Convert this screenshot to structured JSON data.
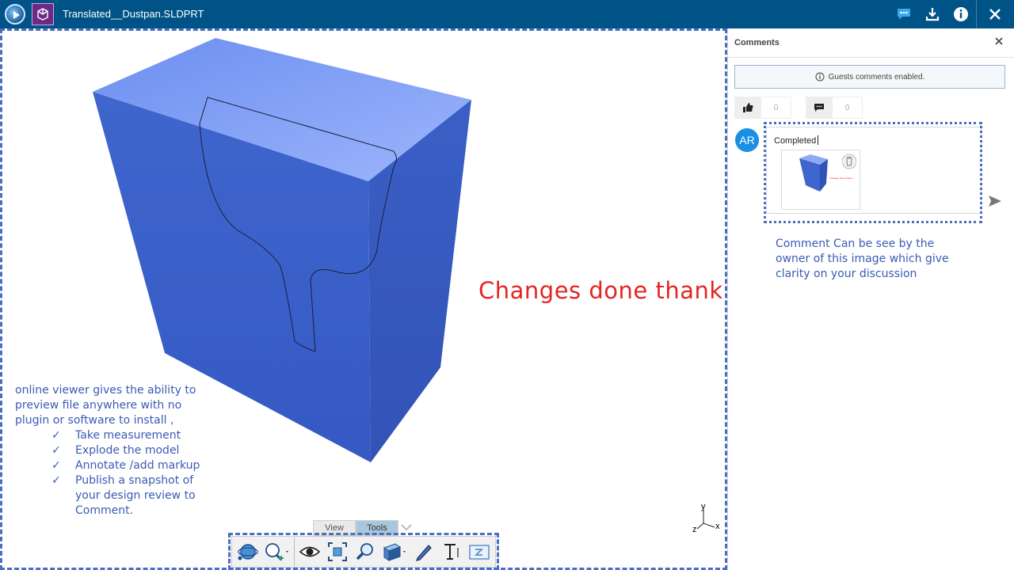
{
  "app": {
    "title": "Translated__Dustpan.SLDPRT",
    "logo_icon": "3d-viewer-play-icon",
    "part_icon": "part-cube-icon",
    "header_buttons": [
      "comments-icon",
      "download-icon",
      "info-icon",
      "close-icon"
    ]
  },
  "viewport": {
    "annotation": {
      "intro_lines": [
        "online viewer gives the ability to",
        "preview file anywhere with no",
        "plugin  or software to install ,"
      ],
      "features": [
        "Take measurement",
        "Explode the model",
        "Annotate  /add markup",
        "Publish  a snapshot  of"
      ],
      "feature_continuation": [
        "your design  review to",
        "Comment."
      ],
      "check_glyph": "✓"
    },
    "red_note": "Changes done thank u",
    "tabs": [
      {
        "label": "View",
        "active": false
      },
      {
        "label": "Tools",
        "active": true
      }
    ],
    "axis": {
      "x": "x",
      "y": "y",
      "z": "z"
    }
  },
  "toolbar": {
    "tools": [
      "orbit-icon",
      "zoom-dropdown-icon",
      "visibility-eye-icon",
      "fit-view-icon",
      "zoom-area-icon",
      "section-view-icon",
      "pen-markup-icon",
      "text-markup-icon",
      "snapshot-icon"
    ]
  },
  "comments_panel": {
    "title": "Comments",
    "guest_banner": "Guests comments enabled.",
    "likes": "0",
    "replies": "0",
    "avatar_initials": "AR",
    "comment_text": "Completed",
    "thumb_caption": "Changes done thank u"
  },
  "side_note": [
    "Comment Can be see by the",
    "owner of this image which give",
    "clarity on your discussion"
  ],
  "colors": {
    "header": "#005386",
    "model_front": "#3a62c9",
    "model_top": "#86a4f5",
    "annotation_blue": "#3a5bb5",
    "annotation_red": "#e52421",
    "avatar": "#1a8fe3"
  }
}
